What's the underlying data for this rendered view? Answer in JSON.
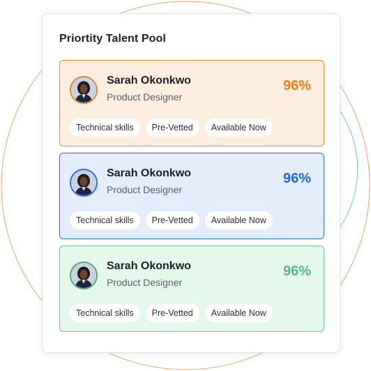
{
  "panel": {
    "title": "Priortity Talent Pool"
  },
  "candidates": [
    {
      "name": "Sarah Okonkwo",
      "role": "Product Designer",
      "score": "96%",
      "tags": [
        "Technical skills",
        "Pre-Vetted",
        "Available Now"
      ],
      "accent": "#f07d18"
    },
    {
      "name": "Sarah Okonkwo",
      "role": "Product Designer",
      "score": "96%",
      "tags": [
        "Technical skills",
        "Pre-Vetted",
        "Available Now"
      ],
      "accent": "#1b6ae0"
    },
    {
      "name": "Sarah Okonkwo",
      "role": "Product Designer",
      "score": "96%",
      "tags": [
        "Technical skills",
        "Pre-Vetted",
        "Available Now"
      ],
      "accent": "#56b77f"
    }
  ],
  "decor": {
    "ring_colors": [
      "#f5a066",
      "#5fd6a0"
    ]
  }
}
